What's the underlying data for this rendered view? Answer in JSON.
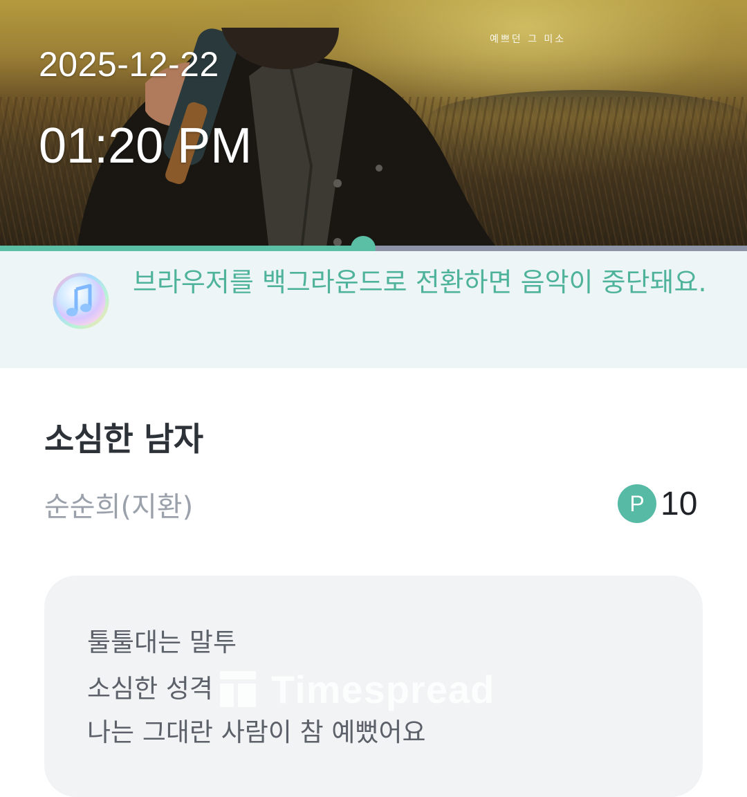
{
  "album": {
    "caption": "예쁘던 그 미소",
    "date": "2025-12-22",
    "time": "01:20 PM"
  },
  "player": {
    "progress": 0.486,
    "accent_color": "#5bbfa6"
  },
  "notice": {
    "icon": "music-note-icon",
    "text": "브라우저를 백그라운드로 전환하면 음악이 중단돼요."
  },
  "song": {
    "title": "소심한 남자",
    "artist": "순순희(지환)",
    "points_icon": "P",
    "points": "10"
  },
  "lyrics": {
    "lines": [
      "툴툴대는 말투",
      "소심한 성격",
      "나는 그대란 사람이 참 예뻤어요"
    ]
  },
  "watermark": {
    "text": "Timespread"
  }
}
